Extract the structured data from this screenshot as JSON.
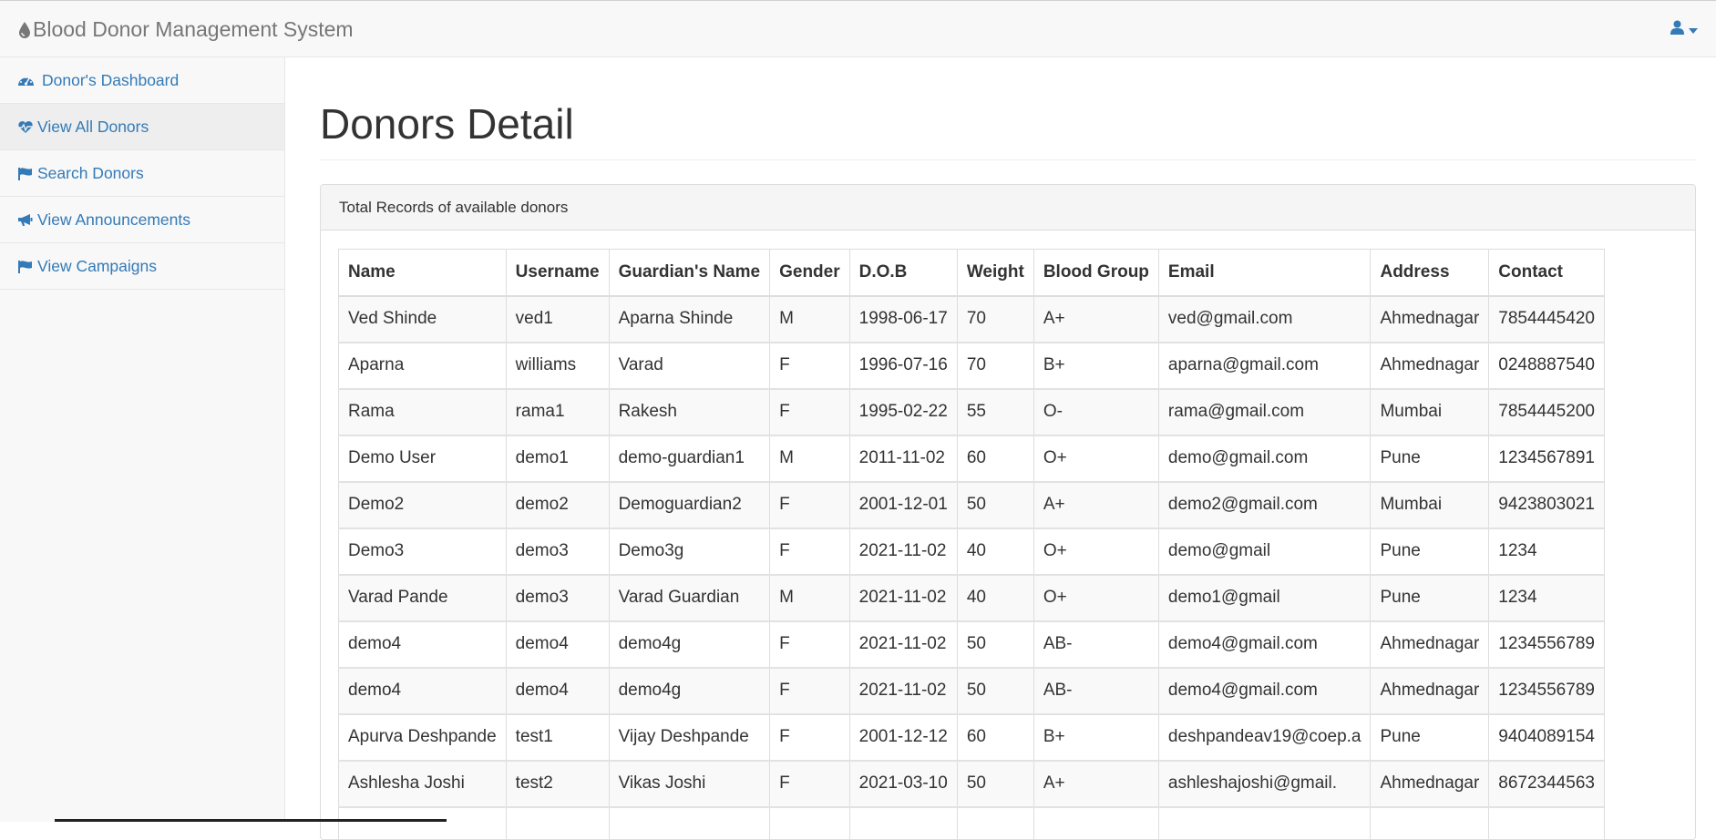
{
  "app": {
    "title": "Blood Donor Management System"
  },
  "sidebar": {
    "items": [
      {
        "label": "Donor's Dashboard",
        "icon": "dashboard-icon"
      },
      {
        "label": "View All Donors",
        "icon": "heartbeat-icon"
      },
      {
        "label": "Search Donors",
        "icon": "flag-icon"
      },
      {
        "label": "View Announcements",
        "icon": "bullhorn-icon"
      },
      {
        "label": "View Campaigns",
        "icon": "flag-icon"
      }
    ],
    "active_index": 1
  },
  "main": {
    "title": "Donors Detail",
    "panel_heading": "Total Records of available donors"
  },
  "table": {
    "headers": [
      "Name",
      "Username",
      "Guardian's Name",
      "Gender",
      "D.O.B",
      "Weight",
      "Blood Group",
      "Email",
      "Address",
      "Contact"
    ],
    "rows": [
      [
        "Ved Shinde",
        "ved1",
        "Aparna Shinde",
        "M",
        "1998-06-17",
        "70",
        "A+",
        "ved@gmail.com",
        "Ahmednagar",
        "7854445420"
      ],
      [
        "Aparna",
        "williams",
        "Varad",
        "F",
        "1996-07-16",
        "70",
        "B+",
        "aparna@gmail.com",
        "Ahmednagar",
        "0248887540"
      ],
      [
        "Rama",
        "rama1",
        "Rakesh",
        "F",
        "1995-02-22",
        "55",
        "O-",
        "rama@gmail.com",
        "Mumbai",
        "7854445200"
      ],
      [
        "Demo User",
        "demo1",
        "demo-guardian1",
        "M",
        "2011-11-02",
        "60",
        "O+",
        "demo@gmail.com",
        "Pune",
        "1234567891"
      ],
      [
        "Demo2",
        "demo2",
        "Demoguardian2",
        "F",
        "2001-12-01",
        "50",
        "A+",
        "demo2@gmail.com",
        "Mumbai",
        "9423803021"
      ],
      [
        "Demo3",
        "demo3",
        "Demo3g",
        "F",
        "2021-11-02",
        "40",
        "O+",
        "demo@gmail",
        "Pune",
        "1234"
      ],
      [
        "Varad Pande",
        "demo3",
        "Varad Guardian",
        "M",
        "2021-11-02",
        "40",
        "O+",
        "demo1@gmail",
        "Pune",
        "1234"
      ],
      [
        "demo4",
        "demo4",
        "demo4g",
        "F",
        "2021-11-02",
        "50",
        "AB-",
        "demo4@gmail.com",
        "Ahmednagar",
        "1234556789"
      ],
      [
        "demo4",
        "demo4",
        "demo4g",
        "F",
        "2021-11-02",
        "50",
        "AB-",
        "demo4@gmail.com",
        "Ahmednagar",
        "1234556789"
      ],
      [
        "Apurva Deshpande",
        "test1",
        "Vijay Deshpande",
        "F",
        "2001-12-12",
        "60",
        "B+",
        "deshpandeav19@coep.a",
        "Pune",
        "9404089154"
      ],
      [
        "Ashlesha Joshi",
        "test2",
        "Vikas Joshi",
        "F",
        "2021-03-10",
        "50",
        "A+",
        "ashleshajoshi@gmail.",
        "Ahmednagar",
        "8672344563"
      ],
      [
        "",
        "",
        "",
        "",
        "",
        "",
        "",
        "",
        "",
        ""
      ]
    ]
  },
  "colors": {
    "link": "#337ab7",
    "brand_text": "#777777",
    "nav_bg": "#f8f8f8",
    "active_bg": "#eeeeee"
  }
}
